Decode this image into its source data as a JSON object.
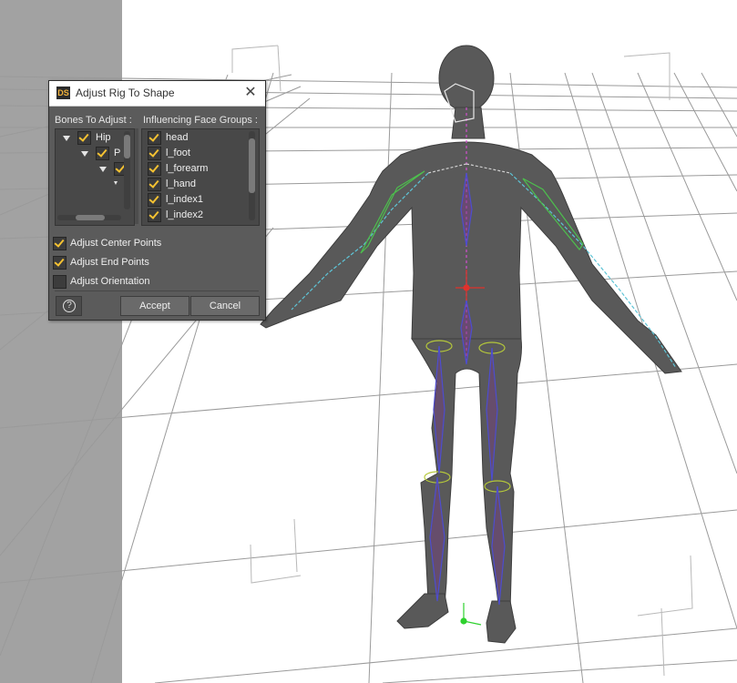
{
  "window": {
    "title": "Adjust Rig To Shape",
    "app_icon_text": "DS"
  },
  "bones": {
    "header": "Bones To Adjust :",
    "items": [
      {
        "label": "Hip",
        "checked": true,
        "expanded": true
      },
      {
        "label": "P",
        "checked": true,
        "expanded": true
      },
      {
        "label": "",
        "checked": true,
        "expanded": true
      }
    ]
  },
  "face_groups": {
    "header": "Influencing Face Groups :",
    "items": [
      {
        "label": "head",
        "checked": true
      },
      {
        "label": "l_foot",
        "checked": true
      },
      {
        "label": "l_forearm",
        "checked": true
      },
      {
        "label": "l_hand",
        "checked": true
      },
      {
        "label": "l_index1",
        "checked": true
      },
      {
        "label": "l_index2",
        "checked": true
      }
    ]
  },
  "options": {
    "center_points": {
      "label": "Adjust Center Points",
      "checked": true
    },
    "end_points": {
      "label": "Adjust End Points",
      "checked": true
    },
    "orientation": {
      "label": "Adjust Orientation",
      "checked": false
    }
  },
  "buttons": {
    "help": "?",
    "accept": "Accept",
    "cancel": "Cancel"
  },
  "icons": {
    "app": "daz-studio-icon",
    "close": "close-icon",
    "help": "help-icon",
    "expand": "expand-arrow-icon",
    "checkbox_checked": "check-icon"
  },
  "colors": {
    "checkmark": "#f5c232",
    "dialog_bg": "#5b5b5b",
    "viewport_bg": "#ffffff"
  }
}
